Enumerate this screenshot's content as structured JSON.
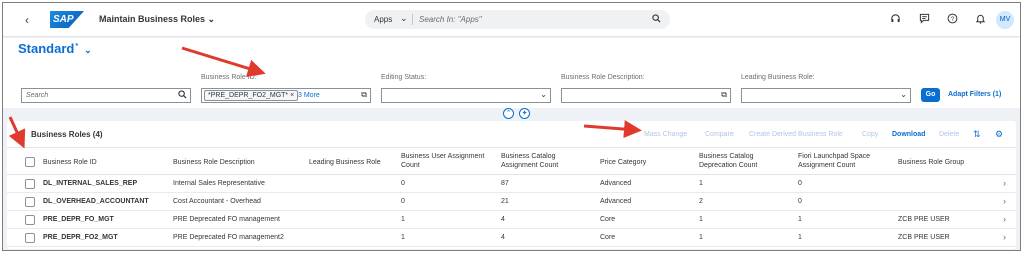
{
  "shell": {
    "app_title": "Maintain Business Roles",
    "logo_text": "SAP",
    "search_scope": "Apps",
    "search_placeholder": "Search In: \"Apps\"",
    "user_initials": "MV"
  },
  "header": {
    "variant_name": "Standard",
    "variant_modified_marker": "*"
  },
  "filters": {
    "search_placeholder": "Search",
    "business_role_id_label": "Business Role ID:",
    "business_role_id_token": "*PRE_DEPR_FO2_MGT*",
    "business_role_id_more": "3 More",
    "editing_status_label": "Editing Status:",
    "description_label": "Business Role Description:",
    "leading_label": "Leading Business Role:",
    "go_label": "Go",
    "adapt_label": "Adapt Filters (1)"
  },
  "table": {
    "title": "Business Roles (4)",
    "toolbar": [
      "Mass Change",
      "Compare",
      "Create Derived Business Role",
      "Copy",
      "Download",
      "Delete"
    ],
    "columns": [
      "Business Role ID",
      "Business Role Description",
      "Leading Business Role",
      "Business User Assignment Count",
      "Business Catalog Assignment Count",
      "Price Category",
      "Business Catalog Deprecation Count",
      "Fiori Launchpad Space Assignment Count",
      "Business Role Group"
    ],
    "rows": [
      {
        "id": "DL_INTERNAL_SALES_REP",
        "desc": "Internal Sales Representative",
        "lead": "",
        "users": "0",
        "catalogs": "87",
        "price": "Advanced",
        "deprec": "1",
        "spaces": "0",
        "group": ""
      },
      {
        "id": "DL_OVERHEAD_ACCOUNTANT",
        "desc": "Cost Accountant - Overhead",
        "lead": "",
        "users": "0",
        "catalogs": "21",
        "price": "Advanced",
        "deprec": "2",
        "spaces": "0",
        "group": ""
      },
      {
        "id": "PRE_DEPR_FO_MGT",
        "desc": "PRE Deprecated FO management",
        "lead": "",
        "users": "1",
        "catalogs": "4",
        "price": "Core",
        "deprec": "1",
        "spaces": "1",
        "group": "ZCB PRE USER"
      },
      {
        "id": "PRE_DEPR_FO2_MGT",
        "desc": "PRE Deprecated FO management2",
        "lead": "",
        "users": "1",
        "catalogs": "4",
        "price": "Core",
        "deprec": "1",
        "spaces": "1",
        "group": "ZCB PRE USER"
      }
    ]
  },
  "colors": {
    "accent": "#0a6ed1",
    "annotation_arrow": "#e03a2e"
  }
}
